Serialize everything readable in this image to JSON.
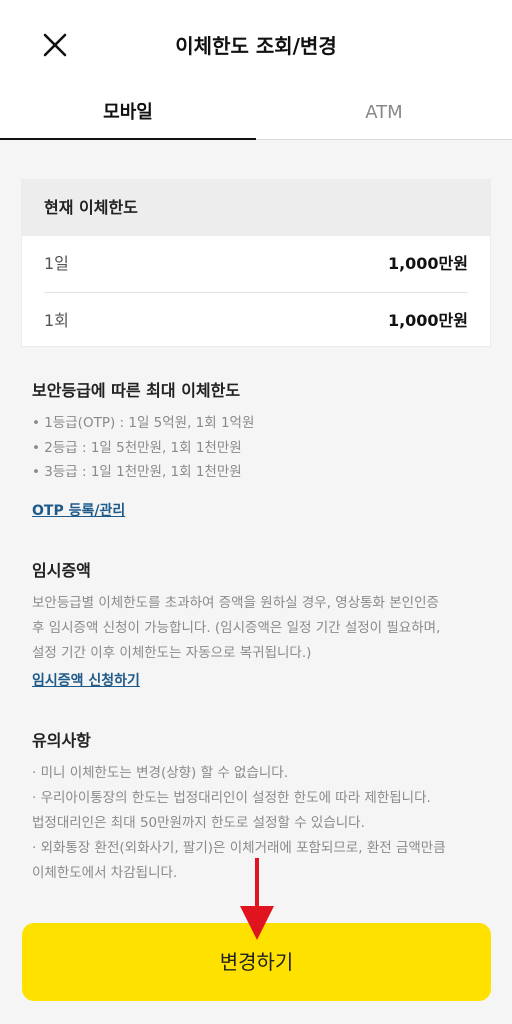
{
  "header": {
    "title": "이체한도 조회/변경",
    "close_icon": "close-icon"
  },
  "tabs": [
    {
      "label": "모바일",
      "active": true
    },
    {
      "label": "ATM",
      "active": false
    }
  ],
  "current_limit": {
    "title": "현재 이체한도",
    "rows": [
      {
        "label": "1일",
        "value": "1,000만원"
      },
      {
        "label": "1회",
        "value": "1,000만원"
      }
    ]
  },
  "security_limits": {
    "title": "보안등급에 따른 최대 이체한도",
    "items": [
      "• 1등급(OTP) : 1일 5억원, 1회 1억원",
      "• 2등급 : 1일 5천만원, 1회 1천만원",
      "• 3등급 : 1일 1천만원, 1회 1천만원"
    ],
    "link": "OTP 등록/관리"
  },
  "temp_increase": {
    "title": "임시증액",
    "lines": [
      "보안등급별 이체한도를 초과하여 증액을 원하실 경우, 영상통화 본인인증",
      "후 임시증액 신청이 가능합니다. (임시증액은 일정 기간 설정이 필요하며,",
      "설정 기간 이후 이체한도는 자동으로 복귀됩니다.)"
    ],
    "link": "임시증액 신청하기"
  },
  "notes": {
    "title": "유의사항",
    "lines": [
      "· 미니 이체한도는 변경(상향) 할 수 없습니다.",
      "· 우리아이통장의 한도는 법정대리인이 설정한 한도에 따라 제한됩니다.",
      "법정대리인은 최대 50만원까지 한도로 설정할 수 있습니다.",
      "· 외화통장 환전(외화사기, 팔기)은 이체거래에 포함되므로, 환전 금액만큼",
      "이체한도에서 차감됩니다."
    ]
  },
  "action": {
    "label": "변경하기"
  },
  "colors": {
    "accent": "#ffe100",
    "link": "#1e5a8a",
    "annotation_arrow": "#e0141e"
  }
}
